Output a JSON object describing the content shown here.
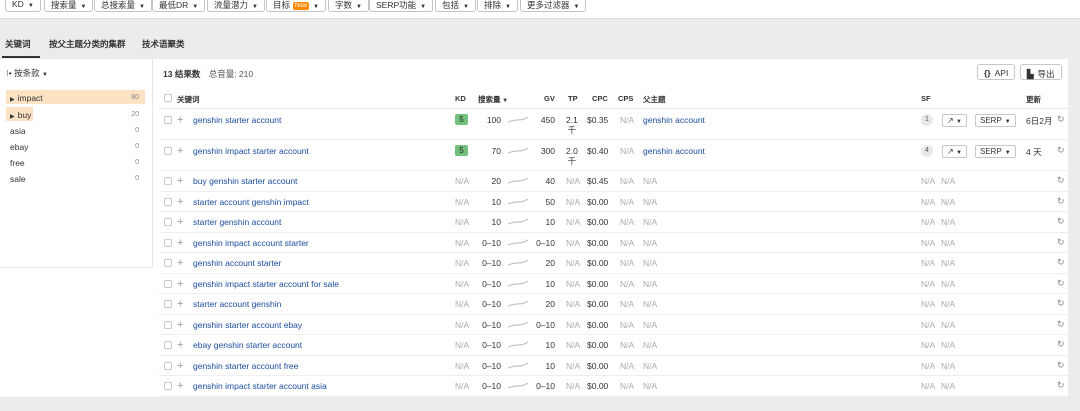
{
  "filters": [
    {
      "label": "KD"
    },
    {
      "label": "搜索量"
    },
    {
      "label": "总搜索量"
    },
    {
      "label": "最低DR"
    },
    {
      "label": "流量潜力"
    },
    {
      "label": "目标",
      "badge": "New"
    },
    {
      "label": "字数"
    },
    {
      "label": "SERP功能"
    },
    {
      "label": "包括"
    },
    {
      "label": "排除"
    },
    {
      "label": "更多过滤器"
    }
  ],
  "tabs": [
    "关键词",
    "按父主题分类的集群",
    "技术语聚类"
  ],
  "sidebar": {
    "sort_label": "按条款",
    "items": [
      {
        "label": "impact",
        "count": "80",
        "highlighted": true,
        "expandable": true
      },
      {
        "label": "buy",
        "count": "20",
        "highlighted": true,
        "expandable": true
      },
      {
        "label": "asia",
        "count": "0"
      },
      {
        "label": "ebay",
        "count": "0"
      },
      {
        "label": "free",
        "count": "0"
      },
      {
        "label": "sale",
        "count": "0"
      }
    ]
  },
  "summary": {
    "count_text": "13 结果数",
    "total_text": "总音量: 210"
  },
  "actions": {
    "api_label": "API",
    "export_label": "导出"
  },
  "columns": {
    "keyword": "关键词",
    "kd": "KD",
    "volume": "搜索量",
    "gv": "GV",
    "tp": "TP",
    "cpc": "CPC",
    "cps": "CPS",
    "parent": "父主题",
    "sf": "SF",
    "updated": "更新"
  },
  "rows": [
    {
      "keyword": "genshin starter account",
      "kd": "5",
      "volume": "100",
      "gv": "450",
      "tp_line1": "2.1",
      "tp_line2": "千",
      "cpc": "$0.35",
      "cps": "N/A",
      "parent": "genshin account",
      "sf": "1",
      "serp": "SERP",
      "updated": "6日2月"
    },
    {
      "keyword": "genshin impact starter account",
      "kd": "5",
      "volume": "70",
      "gv": "300",
      "tp_line1": "2.0",
      "tp_line2": "千",
      "cpc": "$0.40",
      "cps": "N/A",
      "parent": "genshin account",
      "sf": "4",
      "serp": "SERP",
      "updated": "4 天"
    },
    {
      "keyword": "buy genshin starter account",
      "kd": "N/A",
      "volume": "20",
      "gv": "40",
      "tp_line1": "N/A",
      "cpc": "$0.45",
      "cps": "N/A",
      "parent": "N/A",
      "sf": "N/A",
      "sf2": "N/A"
    },
    {
      "keyword": "starter account genshin impact",
      "kd": "N/A",
      "volume": "10",
      "gv": "50",
      "tp_line1": "N/A",
      "cpc": "$0.00",
      "cps": "N/A",
      "parent": "N/A",
      "sf": "N/A",
      "sf2": "N/A"
    },
    {
      "keyword": "starter genshin account",
      "kd": "N/A",
      "volume": "10",
      "gv": "10",
      "tp_line1": "N/A",
      "cpc": "$0.00",
      "cps": "N/A",
      "parent": "N/A",
      "sf": "N/A",
      "sf2": "N/A"
    },
    {
      "keyword": "genshin impact account starter",
      "kd": "N/A",
      "volume": "0–10",
      "gv": "0–10",
      "tp_line1": "N/A",
      "cpc": "$0.00",
      "cps": "N/A",
      "parent": "N/A",
      "sf": "N/A",
      "sf2": "N/A"
    },
    {
      "keyword": "genshin account starter",
      "kd": "N/A",
      "volume": "0–10",
      "gv": "20",
      "tp_line1": "N/A",
      "cpc": "$0.00",
      "cps": "N/A",
      "parent": "N/A",
      "sf": "N/A",
      "sf2": "N/A"
    },
    {
      "keyword": "genshin impact starter account for sale",
      "kd": "N/A",
      "volume": "0–10",
      "gv": "10",
      "tp_line1": "N/A",
      "cpc": "$0.00",
      "cps": "N/A",
      "parent": "N/A",
      "sf": "N/A",
      "sf2": "N/A"
    },
    {
      "keyword": "starter account genshin",
      "kd": "N/A",
      "volume": "0–10",
      "gv": "20",
      "tp_line1": "N/A",
      "cpc": "$0.00",
      "cps": "N/A",
      "parent": "N/A",
      "sf": "N/A",
      "sf2": "N/A"
    },
    {
      "keyword": "genshin starter account ebay",
      "kd": "N/A",
      "volume": "0–10",
      "gv": "0–10",
      "tp_line1": "N/A",
      "cpc": "$0.00",
      "cps": "N/A",
      "parent": "N/A",
      "sf": "N/A",
      "sf2": "N/A"
    },
    {
      "keyword": "ebay genshin starter account",
      "kd": "N/A",
      "volume": "0–10",
      "gv": "10",
      "tp_line1": "N/A",
      "cpc": "$0.00",
      "cps": "N/A",
      "parent": "N/A",
      "sf": "N/A",
      "sf2": "N/A"
    },
    {
      "keyword": "genshin starter account free",
      "kd": "N/A",
      "volume": "0–10",
      "gv": "10",
      "tp_line1": "N/A",
      "cpc": "$0.00",
      "cps": "N/A",
      "parent": "N/A",
      "sf": "N/A",
      "sf2": "N/A"
    },
    {
      "keyword": "genshin impact starter account asia",
      "kd": "N/A",
      "volume": "0–10",
      "gv": "0–10",
      "tp_line1": "N/A",
      "cpc": "$0.00",
      "cps": "N/A",
      "parent": "N/A",
      "sf": "N/A",
      "sf2": "N/A"
    }
  ],
  "colors": {
    "accent_link": "#1a4da0",
    "kd_easy": "#73c07d",
    "highlight": "#fde2c4",
    "badge_new": "#ff8a00"
  }
}
